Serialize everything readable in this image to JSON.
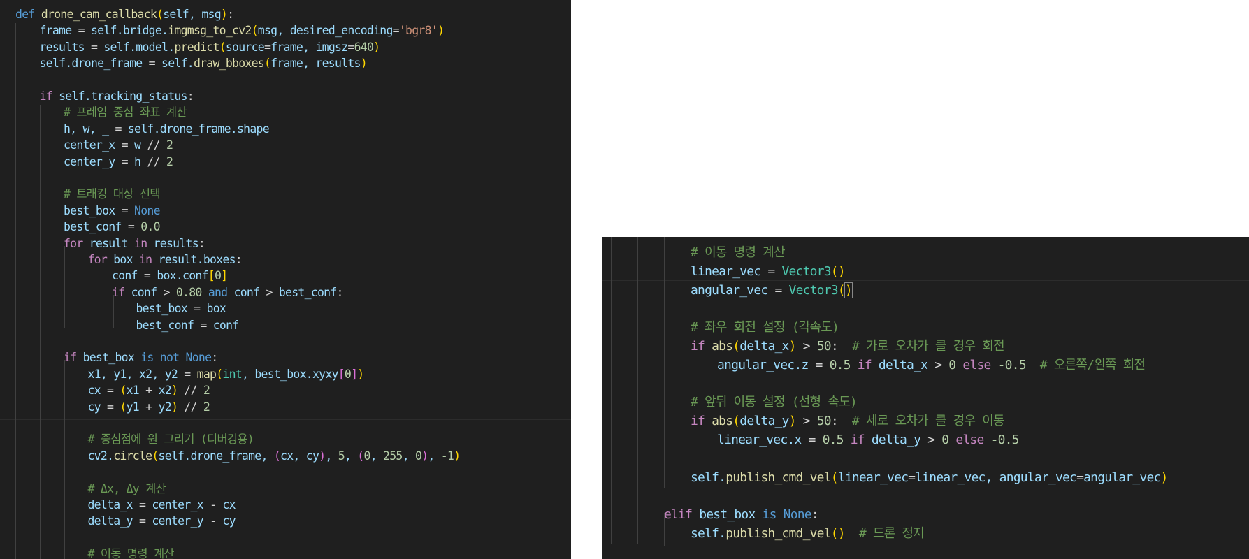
{
  "colors": {
    "editor_bg": "#1f1f1f",
    "page_bg": "#ffffff",
    "keyword": "#c586c0",
    "def_keyword": "#569cd6",
    "function": "#dcdcaa",
    "string": "#ce9178",
    "number": "#b5cea8",
    "comment": "#6a9955",
    "class": "#4ec9b0",
    "constant": "#569cd6",
    "variable": "#9cdcfe",
    "bracket_level1": "#ffd700",
    "bracket_level2": "#da70d6",
    "bracket_level3": "#179fff"
  },
  "left_panel": {
    "lines": [
      {
        "indent": 0,
        "tokens": [
          [
            "def",
            "def"
          ],
          [
            "t",
            " "
          ],
          [
            "fn",
            "drone_cam_callback"
          ],
          [
            "b1",
            "("
          ],
          [
            "var",
            "self, msg"
          ],
          [
            "b1",
            ")"
          ],
          [
            "op",
            ":"
          ]
        ]
      },
      {
        "indent": 1,
        "tokens": [
          [
            "var",
            "frame"
          ],
          [
            "op",
            " = "
          ],
          [
            "var",
            "self.bridge."
          ],
          [
            "fn",
            "imgmsg_to_cv2"
          ],
          [
            "b1",
            "("
          ],
          [
            "var",
            "msg, desired_encoding"
          ],
          [
            "op",
            "="
          ],
          [
            "str",
            "'bgr8'"
          ],
          [
            "b1",
            ")"
          ]
        ]
      },
      {
        "indent": 1,
        "tokens": [
          [
            "var",
            "results"
          ],
          [
            "op",
            " = "
          ],
          [
            "var",
            "self.model."
          ],
          [
            "fn",
            "predict"
          ],
          [
            "b1",
            "("
          ],
          [
            "var",
            "source"
          ],
          [
            "op",
            "="
          ],
          [
            "var",
            "frame, imgsz"
          ],
          [
            "op",
            "="
          ],
          [
            "num",
            "640"
          ],
          [
            "b1",
            ")"
          ]
        ]
      },
      {
        "indent": 1,
        "tokens": [
          [
            "var",
            "self.drone_frame"
          ],
          [
            "op",
            " = "
          ],
          [
            "var",
            "self."
          ],
          [
            "fn",
            "draw_bboxes"
          ],
          [
            "b1",
            "("
          ],
          [
            "var",
            "frame, results"
          ],
          [
            "b1",
            ")"
          ]
        ]
      },
      {
        "indent": 0,
        "tokens": []
      },
      {
        "indent": 1,
        "tokens": [
          [
            "kw",
            "if"
          ],
          [
            "t",
            " "
          ],
          [
            "var",
            "self.tracking_status"
          ],
          [
            "op",
            ":"
          ]
        ]
      },
      {
        "indent": 2,
        "tokens": [
          [
            "cm",
            "# 프레임 중심 좌표 계산"
          ]
        ]
      },
      {
        "indent": 2,
        "tokens": [
          [
            "var",
            "h, w, _"
          ],
          [
            "op",
            " = "
          ],
          [
            "var",
            "self.drone_frame.shape"
          ]
        ]
      },
      {
        "indent": 2,
        "tokens": [
          [
            "var",
            "center_x"
          ],
          [
            "op",
            " = "
          ],
          [
            "var",
            "w"
          ],
          [
            "op",
            " // "
          ],
          [
            "num",
            "2"
          ]
        ]
      },
      {
        "indent": 2,
        "tokens": [
          [
            "var",
            "center_y"
          ],
          [
            "op",
            " = "
          ],
          [
            "var",
            "h"
          ],
          [
            "op",
            " // "
          ],
          [
            "num",
            "2"
          ]
        ]
      },
      {
        "indent": 0,
        "tokens": []
      },
      {
        "indent": 2,
        "tokens": [
          [
            "cm",
            "# 트래킹 대상 선택"
          ]
        ]
      },
      {
        "indent": 2,
        "tokens": [
          [
            "var",
            "best_box"
          ],
          [
            "op",
            " = "
          ],
          [
            "kc",
            "None"
          ]
        ]
      },
      {
        "indent": 2,
        "tokens": [
          [
            "var",
            "best_conf"
          ],
          [
            "op",
            " = "
          ],
          [
            "num",
            "0.0"
          ]
        ]
      },
      {
        "indent": 2,
        "tokens": [
          [
            "kw",
            "for"
          ],
          [
            "t",
            " "
          ],
          [
            "var",
            "result"
          ],
          [
            "t",
            " "
          ],
          [
            "kw",
            "in"
          ],
          [
            "t",
            " "
          ],
          [
            "var",
            "results"
          ],
          [
            "op",
            ":"
          ]
        ]
      },
      {
        "indent": 3,
        "tokens": [
          [
            "kw",
            "for"
          ],
          [
            "t",
            " "
          ],
          [
            "var",
            "box"
          ],
          [
            "t",
            " "
          ],
          [
            "kw",
            "in"
          ],
          [
            "t",
            " "
          ],
          [
            "var",
            "result.boxes"
          ],
          [
            "op",
            ":"
          ]
        ]
      },
      {
        "indent": 4,
        "tokens": [
          [
            "var",
            "conf"
          ],
          [
            "op",
            " = "
          ],
          [
            "var",
            "box.conf"
          ],
          [
            "b1",
            "["
          ],
          [
            "num",
            "0"
          ],
          [
            "b1",
            "]"
          ]
        ]
      },
      {
        "indent": 4,
        "tokens": [
          [
            "kw",
            "if"
          ],
          [
            "t",
            " "
          ],
          [
            "var",
            "conf"
          ],
          [
            "op",
            " > "
          ],
          [
            "num",
            "0.80"
          ],
          [
            "t",
            " "
          ],
          [
            "kc",
            "and"
          ],
          [
            "t",
            " "
          ],
          [
            "var",
            "conf"
          ],
          [
            "op",
            " > "
          ],
          [
            "var",
            "best_conf"
          ],
          [
            "op",
            ":"
          ]
        ]
      },
      {
        "indent": 5,
        "tokens": [
          [
            "var",
            "best_box"
          ],
          [
            "op",
            " = "
          ],
          [
            "var",
            "box"
          ]
        ]
      },
      {
        "indent": 5,
        "tokens": [
          [
            "var",
            "best_conf"
          ],
          [
            "op",
            " = "
          ],
          [
            "var",
            "conf"
          ]
        ]
      },
      {
        "indent": 0,
        "tokens": []
      },
      {
        "indent": 2,
        "tokens": [
          [
            "kw",
            "if"
          ],
          [
            "t",
            " "
          ],
          [
            "var",
            "best_box"
          ],
          [
            "t",
            " "
          ],
          [
            "kc",
            "is not"
          ],
          [
            "t",
            " "
          ],
          [
            "kc",
            "None"
          ],
          [
            "op",
            ":"
          ]
        ]
      },
      {
        "indent": 3,
        "tokens": [
          [
            "var",
            "x1, y1, x2, y2"
          ],
          [
            "op",
            " = "
          ],
          [
            "fn",
            "map"
          ],
          [
            "b1",
            "("
          ],
          [
            "cls",
            "int"
          ],
          [
            "var",
            ", best_box.xyxy"
          ],
          [
            "b2",
            "["
          ],
          [
            "num",
            "0"
          ],
          [
            "b2",
            "]"
          ],
          [
            "b1",
            ")"
          ]
        ]
      },
      {
        "indent": 3,
        "tokens": [
          [
            "var",
            "cx"
          ],
          [
            "op",
            " = "
          ],
          [
            "b1",
            "("
          ],
          [
            "var",
            "x1"
          ],
          [
            "op",
            " + "
          ],
          [
            "var",
            "x2"
          ],
          [
            "b1",
            ")"
          ],
          [
            "op",
            " // "
          ],
          [
            "num",
            "2"
          ]
        ]
      },
      {
        "indent": 3,
        "tokens": [
          [
            "var",
            "cy"
          ],
          [
            "op",
            " = "
          ],
          [
            "b1",
            "("
          ],
          [
            "var",
            "y1"
          ],
          [
            "op",
            " + "
          ],
          [
            "var",
            "y2"
          ],
          [
            "b1",
            ")"
          ],
          [
            "op",
            " // "
          ],
          [
            "num",
            "2"
          ]
        ]
      },
      {
        "indent": 0,
        "tokens": []
      },
      {
        "indent": 3,
        "tokens": [
          [
            "cm",
            "# 중심점에 원 그리기 (디버깅용)"
          ]
        ]
      },
      {
        "indent": 3,
        "tokens": [
          [
            "var",
            "cv2."
          ],
          [
            "fn",
            "circle"
          ],
          [
            "b1",
            "("
          ],
          [
            "var",
            "self.drone_frame, "
          ],
          [
            "b2",
            "("
          ],
          [
            "var",
            "cx, cy"
          ],
          [
            "b2",
            ")"
          ],
          [
            "var",
            ", "
          ],
          [
            "num",
            "5"
          ],
          [
            "var",
            ", "
          ],
          [
            "b2",
            "("
          ],
          [
            "num",
            "0"
          ],
          [
            "var",
            ", "
          ],
          [
            "num",
            "255"
          ],
          [
            "var",
            ", "
          ],
          [
            "num",
            "0"
          ],
          [
            "b2",
            ")"
          ],
          [
            "var",
            ", "
          ],
          [
            "num",
            "-1"
          ],
          [
            "b1",
            ")"
          ]
        ]
      },
      {
        "indent": 0,
        "tokens": []
      },
      {
        "indent": 3,
        "tokens": [
          [
            "cm",
            "# Δx, Δy 계산"
          ]
        ]
      },
      {
        "indent": 3,
        "tokens": [
          [
            "var",
            "delta_x"
          ],
          [
            "op",
            " = "
          ],
          [
            "var",
            "center_x"
          ],
          [
            "op",
            " - "
          ],
          [
            "var",
            "cx"
          ]
        ]
      },
      {
        "indent": 3,
        "tokens": [
          [
            "var",
            "delta_y"
          ],
          [
            "op",
            " = "
          ],
          [
            "var",
            "center_y"
          ],
          [
            "op",
            " - "
          ],
          [
            "var",
            "cy"
          ]
        ]
      },
      {
        "indent": 0,
        "tokens": []
      },
      {
        "indent": 3,
        "tokens": [
          [
            "cm",
            "# 이동 명령 계산"
          ]
        ]
      }
    ]
  },
  "right_panel": {
    "lines": [
      {
        "indent": 3,
        "tokens": [
          [
            "cm",
            "# 이동 명령 계산"
          ]
        ]
      },
      {
        "indent": 3,
        "tokens": [
          [
            "var",
            "linear_vec"
          ],
          [
            "op",
            " = "
          ],
          [
            "cls",
            "Vector3"
          ],
          [
            "b1",
            "("
          ],
          [
            "b1",
            ")"
          ]
        ]
      },
      {
        "indent": 3,
        "tokens": [
          [
            "var",
            "angular_vec"
          ],
          [
            "op",
            " = "
          ],
          [
            "cls",
            "Vector3"
          ],
          [
            "b1",
            "("
          ],
          [
            "b1b",
            ")"
          ]
        ]
      },
      {
        "indent": 0,
        "tokens": []
      },
      {
        "indent": 3,
        "tokens": [
          [
            "cm",
            "# 좌우 회전 설정 (각속도)"
          ]
        ]
      },
      {
        "indent": 3,
        "tokens": [
          [
            "kw",
            "if"
          ],
          [
            "t",
            " "
          ],
          [
            "fn",
            "abs"
          ],
          [
            "b1",
            "("
          ],
          [
            "var",
            "delta_x"
          ],
          [
            "b1",
            ")"
          ],
          [
            "op",
            " > "
          ],
          [
            "num",
            "50"
          ],
          [
            "op",
            ":  "
          ],
          [
            "cm",
            "# 가로 오차가 클 경우 회전"
          ]
        ]
      },
      {
        "indent": 4,
        "tokens": [
          [
            "var",
            "angular_vec.z"
          ],
          [
            "op",
            " = "
          ],
          [
            "num",
            "0.5"
          ],
          [
            "t",
            " "
          ],
          [
            "kw",
            "if"
          ],
          [
            "t",
            " "
          ],
          [
            "var",
            "delta_x"
          ],
          [
            "op",
            " > "
          ],
          [
            "num",
            "0"
          ],
          [
            "t",
            " "
          ],
          [
            "kw",
            "else"
          ],
          [
            "t",
            " "
          ],
          [
            "num",
            "-0.5"
          ],
          [
            "op",
            "  "
          ],
          [
            "cm",
            "# 오른쪽/왼쪽 회전"
          ]
        ]
      },
      {
        "indent": 0,
        "tokens": []
      },
      {
        "indent": 3,
        "tokens": [
          [
            "cm",
            "# 앞뒤 이동 설정 (선형 속도)"
          ]
        ]
      },
      {
        "indent": 3,
        "tokens": [
          [
            "kw",
            "if"
          ],
          [
            "t",
            " "
          ],
          [
            "fn",
            "abs"
          ],
          [
            "b1",
            "("
          ],
          [
            "var",
            "delta_y"
          ],
          [
            "b1",
            ")"
          ],
          [
            "op",
            " > "
          ],
          [
            "num",
            "50"
          ],
          [
            "op",
            ":  "
          ],
          [
            "cm",
            "# 세로 오차가 클 경우 이동"
          ]
        ]
      },
      {
        "indent": 4,
        "tokens": [
          [
            "var",
            "linear_vec.x"
          ],
          [
            "op",
            " = "
          ],
          [
            "num",
            "0.5"
          ],
          [
            "t",
            " "
          ],
          [
            "kw",
            "if"
          ],
          [
            "t",
            " "
          ],
          [
            "var",
            "delta_y"
          ],
          [
            "op",
            " > "
          ],
          [
            "num",
            "0"
          ],
          [
            "t",
            " "
          ],
          [
            "kw",
            "else"
          ],
          [
            "t",
            " "
          ],
          [
            "num",
            "-0.5"
          ]
        ]
      },
      {
        "indent": 0,
        "tokens": []
      },
      {
        "indent": 3,
        "tokens": [
          [
            "var",
            "self."
          ],
          [
            "fn",
            "publish_cmd_vel"
          ],
          [
            "b1",
            "("
          ],
          [
            "var",
            "linear_vec"
          ],
          [
            "op",
            "="
          ],
          [
            "var",
            "linear_vec, angular_vec"
          ],
          [
            "op",
            "="
          ],
          [
            "var",
            "angular_vec"
          ],
          [
            "b1",
            ")"
          ]
        ]
      },
      {
        "indent": 0,
        "tokens": []
      },
      {
        "indent": 2,
        "tokens": [
          [
            "kw",
            "elif"
          ],
          [
            "t",
            " "
          ],
          [
            "var",
            "best_box"
          ],
          [
            "t",
            " "
          ],
          [
            "kc",
            "is"
          ],
          [
            "t",
            " "
          ],
          [
            "kc",
            "None"
          ],
          [
            "op",
            ":"
          ]
        ]
      },
      {
        "indent": 3,
        "tokens": [
          [
            "var",
            "self."
          ],
          [
            "fn",
            "publish_cmd_vel"
          ],
          [
            "b1",
            "("
          ],
          [
            "b1",
            ")"
          ],
          [
            "op",
            "  "
          ],
          [
            "cm",
            "# 드론 정지"
          ]
        ]
      }
    ]
  }
}
